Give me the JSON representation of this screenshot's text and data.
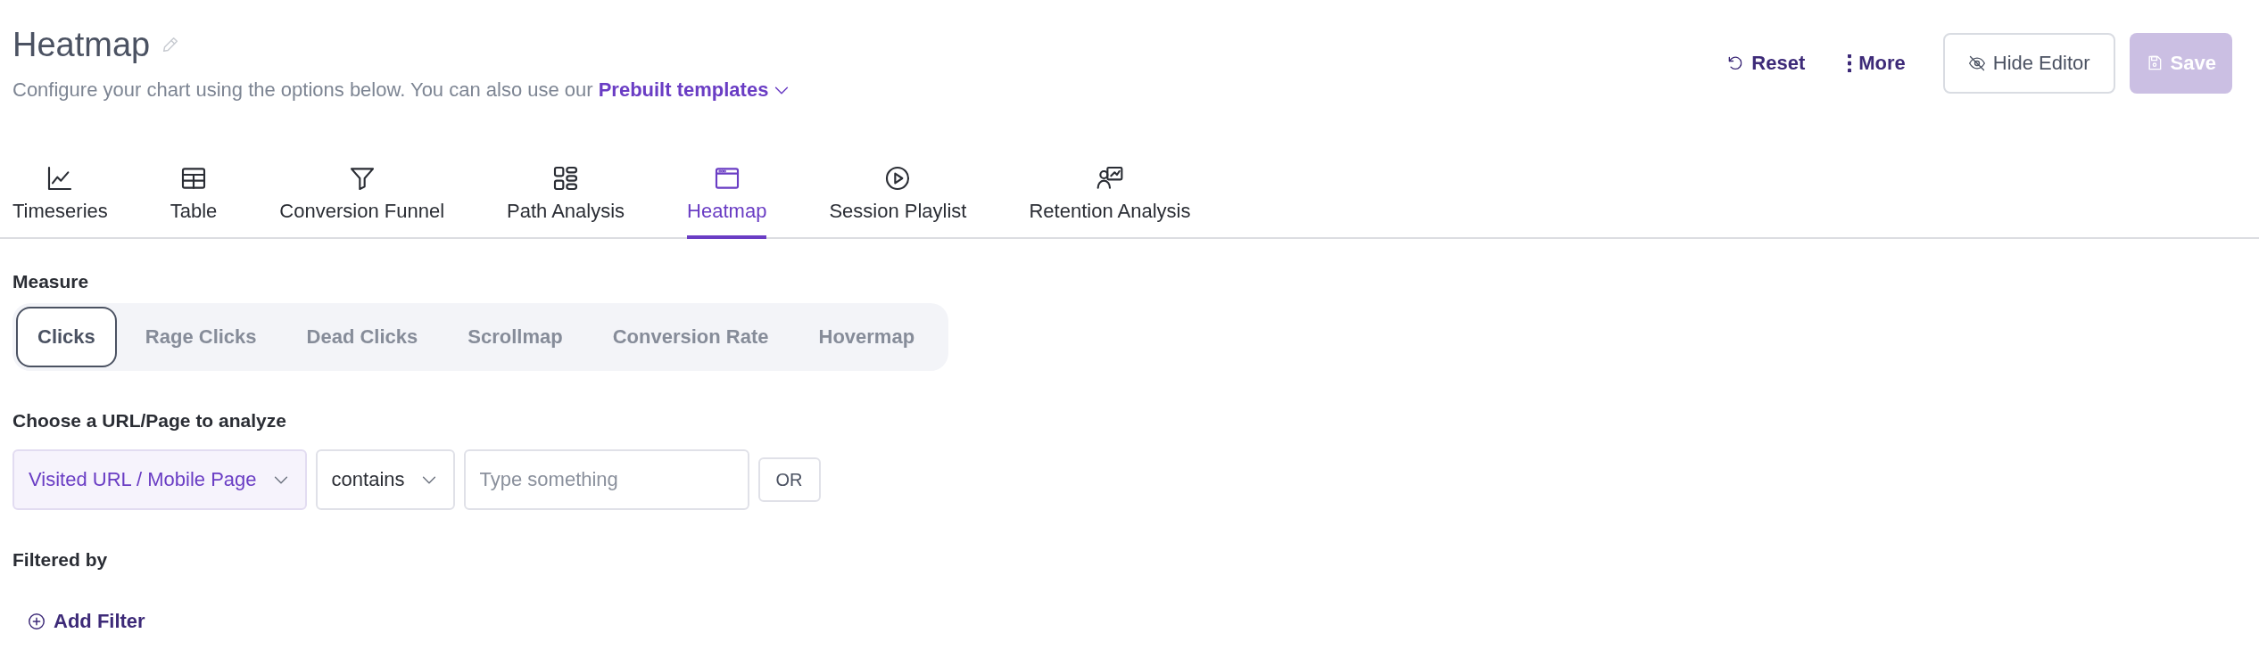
{
  "header": {
    "title": "Heatmap",
    "subtitle": "Configure your chart using the options below. You can also use our",
    "templates_link": "Prebuilt templates"
  },
  "actions": [
    {
      "kind": "link",
      "label": "Reset"
    },
    {
      "kind": "link",
      "label": "More"
    },
    {
      "kind": "outline",
      "label": "Hide Editor",
      "disabled": false
    },
    {
      "kind": "primary",
      "label": "Save",
      "disabled": true
    }
  ],
  "tabs": [
    {
      "label": "Timeseries",
      "selected": false
    },
    {
      "label": "Table",
      "selected": false
    },
    {
      "label": "Conversion Funnel",
      "selected": false
    },
    {
      "label": "Path Analysis",
      "selected": false
    },
    {
      "label": "Heatmap",
      "selected": true
    },
    {
      "label": "Session Playlist",
      "selected": false
    },
    {
      "label": "Retention Analysis",
      "selected": false
    }
  ],
  "measure": {
    "label": "Measure",
    "options": [
      {
        "label": "Clicks",
        "selected": true
      },
      {
        "label": "Rage Clicks",
        "selected": false
      },
      {
        "label": "Dead Clicks",
        "selected": false
      },
      {
        "label": "Scrollmap",
        "selected": false
      },
      {
        "label": "Conversion Rate",
        "selected": false
      },
      {
        "label": "Hovermap",
        "selected": false
      }
    ]
  },
  "url_filter": {
    "label": "Choose a URL/Page to analyze",
    "property": "Visited URL / Mobile Page",
    "operator": "contains",
    "value_placeholder": "Type something",
    "or_button": "OR"
  },
  "filters": {
    "label": "Filtered by",
    "add_button": "Add Filter"
  }
}
